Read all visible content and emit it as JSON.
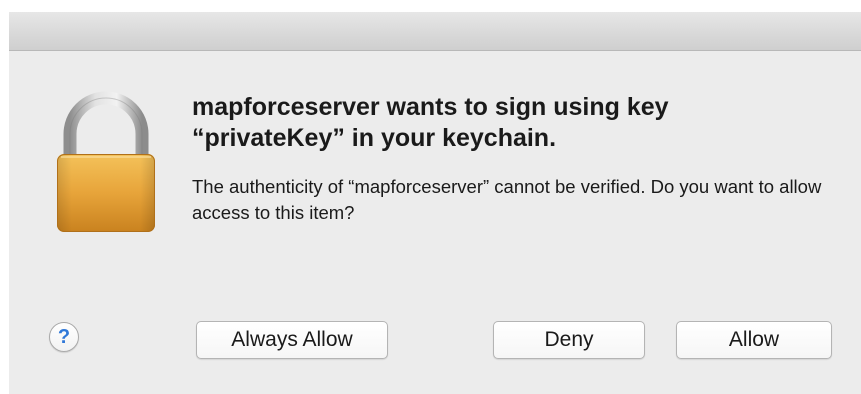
{
  "dialog": {
    "title": "mapforceserver wants to sign using key “privateKey” in your keychain.",
    "message": "The authenticity of “mapforceserver” cannot be verified. Do you want to allow access to this item?",
    "icon": "lock-icon",
    "help": {
      "label": "?",
      "icon": "help-icon"
    },
    "buttons": {
      "always_allow": "Always Allow",
      "deny": "Deny",
      "allow": "Allow"
    }
  },
  "colors": {
    "window_background": "#ececec",
    "lock_body": "#e8a53a",
    "lock_shackle": "#b8b8b8",
    "help_glyph": "#2f78d8"
  }
}
